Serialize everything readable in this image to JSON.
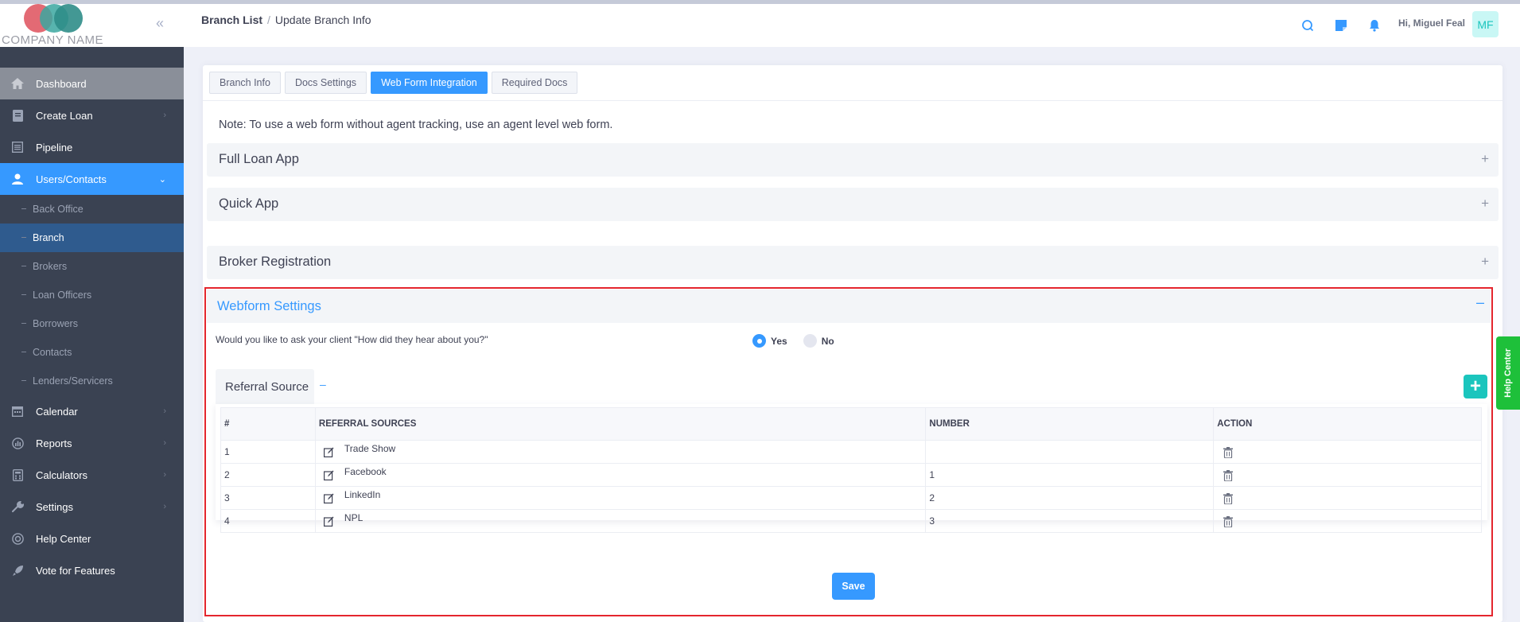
{
  "brand": {
    "company": "COMPANY NAME"
  },
  "sidebar": {
    "items": [
      {
        "label": "Dashboard",
        "icon": "home-icon"
      },
      {
        "label": "Create Loan",
        "icon": "document-icon"
      },
      {
        "label": "Pipeline",
        "icon": "list-icon"
      },
      {
        "label": "Users/Contacts",
        "icon": "user-icon"
      },
      {
        "label": "Calendar",
        "icon": "calendar-icon"
      },
      {
        "label": "Reports",
        "icon": "chart-icon"
      },
      {
        "label": "Calculators",
        "icon": "calculator-icon"
      },
      {
        "label": "Settings",
        "icon": "wrench-icon"
      },
      {
        "label": "Help Center",
        "icon": "lifebuoy-icon"
      },
      {
        "label": "Vote for Features",
        "icon": "rocket-icon"
      }
    ],
    "sub_items": [
      "Back Office",
      "Branch",
      "Brokers",
      "Loan Officers",
      "Borrowers",
      "Contacts",
      "Lenders/Servicers"
    ]
  },
  "header": {
    "breadcrumb_root": "Branch List",
    "breadcrumb_sep": "/",
    "breadcrumb_current": "Update Branch Info",
    "greeting": "Hi, Miguel Feal",
    "avatar_initials": "MF"
  },
  "tabs": [
    "Branch Info",
    "Docs Settings",
    "Web Form Integration",
    "Required Docs"
  ],
  "note": "Note: To use a web form without agent tracking, use an agent level web form.",
  "accordions": {
    "full_loan_app": "Full Loan App",
    "quick_app": "Quick App",
    "broker_registration": "Broker Registration",
    "webform_settings": "Webform Settings"
  },
  "webform": {
    "question": "Would you like to ask your client \"How did they hear about you?\"",
    "yes_label": "Yes",
    "no_label": "No",
    "selected": "Yes",
    "referral_title": "Referral Source",
    "columns": [
      "#",
      "REFERRAL SOURCES",
      "NUMBER",
      "ACTION"
    ],
    "rows": [
      {
        "n": "1",
        "source": "Trade Show",
        "number": ""
      },
      {
        "n": "2",
        "source": "Facebook",
        "number": "1"
      },
      {
        "n": "3",
        "source": "LinkedIn",
        "number": "2"
      },
      {
        "n": "4",
        "source": "NPL",
        "number": "3"
      }
    ],
    "save_label": "Save"
  },
  "help_tab": "Help Center",
  "colors": {
    "primary": "#3699ff",
    "sidebar": "#3a4252",
    "success": "#1bc5bd",
    "help_green": "#1ec03a",
    "highlight_border": "#e4262e"
  }
}
